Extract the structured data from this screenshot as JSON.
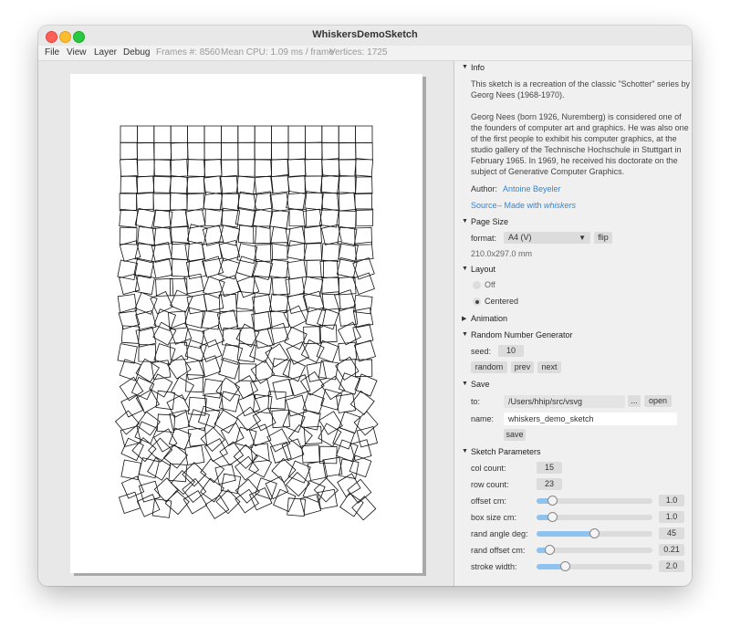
{
  "window": {
    "title": "WhiskersDemoSketch"
  },
  "menu": {
    "file": "File",
    "view": "View",
    "layer": "Layer",
    "debug": "Debug",
    "frames": "Frames #: 8560",
    "cpu": "Mean CPU: 1.09 ms / frame",
    "vertices": "Vertices: 1725"
  },
  "info": {
    "header": "Info",
    "para1": "This sketch is a recreation of the classic \"Schotter\" series by Georg Nees (1968-1970).",
    "para2": "Georg Nees (born 1926, Nuremberg) is considered one of the founders of computer art and graphics. He was also one of the first people to exhibit his computer graphics, at the studio gallery of the Technische Hochschule in Stuttgart in February 1965. In 1969, he received his doctorate on the subject of Generative Computer Graphics.",
    "author_label": "Author:",
    "author_name": "Antoine Beyeler",
    "source": "Source",
    "made_with": "– Made with",
    "whiskers": "whiskers"
  },
  "page_size": {
    "header": "Page Size",
    "format_label": "format:",
    "format_value": "A4 (V)",
    "flip": "flip",
    "dims": "210.0x297.0 mm"
  },
  "layout": {
    "header": "Layout",
    "off": "Off",
    "centered": "Centered",
    "selected": "Centered"
  },
  "animation": {
    "header": "Animation"
  },
  "rng": {
    "header": "Random Number Generator",
    "seed_label": "seed:",
    "seed_value": "10",
    "random": "random",
    "prev": "prev",
    "next": "next"
  },
  "save": {
    "header": "Save",
    "to_label": "to:",
    "to_value": "/Users/hhip/src/vsvg",
    "ellipsis": "...",
    "open": "open",
    "name_label": "name:",
    "name_value": "whiskers_demo_sketch",
    "save_btn": "save"
  },
  "params": {
    "header": "Sketch Parameters",
    "col_count_label": "col count:",
    "col_count": "15",
    "row_count_label": "row count:",
    "row_count": "23",
    "sliders": [
      {
        "label": "offset cm:",
        "value": "1.0",
        "fraction": 0.1
      },
      {
        "label": "box size cm:",
        "value": "1.0",
        "fraction": 0.1
      },
      {
        "label": "rand angle deg:",
        "value": "45",
        "fraction": 0.5
      },
      {
        "label": "rand offset cm:",
        "value": "0.21",
        "fraction": 0.08
      },
      {
        "label": "stroke width:",
        "value": "2.0",
        "fraction": 0.22
      }
    ]
  },
  "colors": {
    "accent": "#2f86d6",
    "slider_fill": "#8ec3f0"
  }
}
